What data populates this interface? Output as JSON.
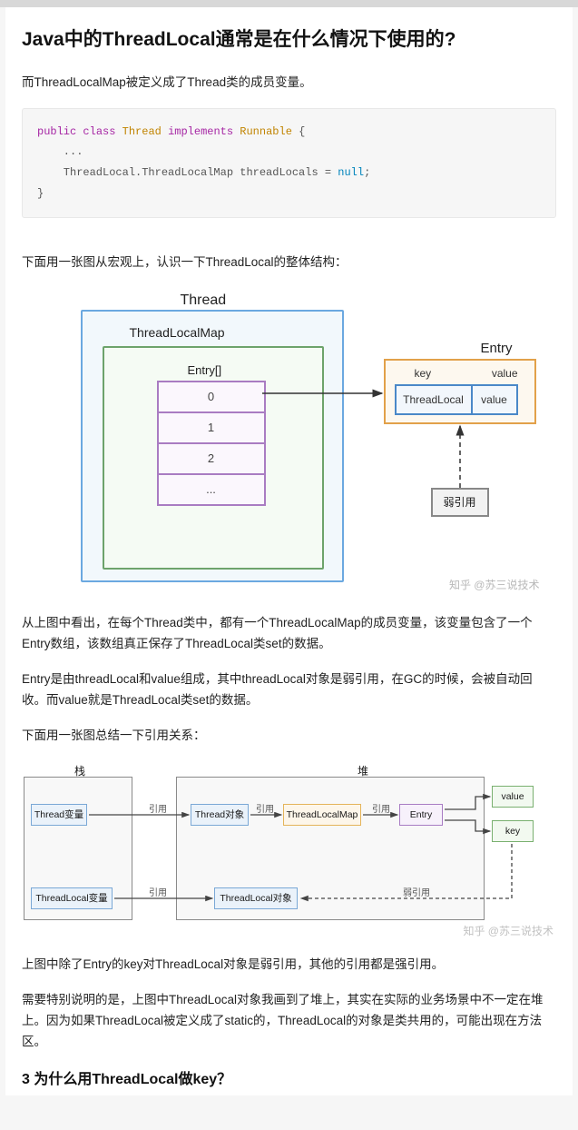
{
  "title": "Java中的ThreadLocal通常是在什么情况下使用的?",
  "paragraphs": {
    "p1": "而ThreadLocalMap被定义成了Thread类的成员变量。",
    "p2": "下面用一张图从宏观上，认识一下ThreadLocal的整体结构：",
    "p3": "从上图中看出，在每个Thread类中，都有一个ThreadLocalMap的成员变量，该变量包含了一个Entry数组，该数组真正保存了ThreadLocal类set的数据。",
    "p4": "Entry是由threadLocal和value组成，其中threadLocal对象是弱引用，在GC的时候，会被自动回收。而value就是ThreadLocal类set的数据。",
    "p5": "下面用一张图总结一下引用关系：",
    "p6": "上图中除了Entry的key对ThreadLocal对象是弱引用，其他的引用都是强引用。",
    "p7": "需要特别说明的是，上图中ThreadLocal对象我画到了堆上，其实在实际的业务场景中不一定在堆上。因为如果ThreadLocal被定义成了static的，ThreadLocal的对象是类共用的，可能出现在方法区。"
  },
  "code": {
    "kw_public": "public",
    "kw_class": "class",
    "type_thread": "Thread",
    "kw_implements": "implements",
    "type_runnable": "Runnable",
    "brace_open": " {",
    "ellipsis": "    ...",
    "field_line_a": "    ThreadLocal.ThreadLocalMap threadLocals = ",
    "lit_null": "null",
    "semicolon": ";",
    "brace_close": "}"
  },
  "diagram1": {
    "thread": "Thread",
    "map": "ThreadLocalMap",
    "entry_array": "Entry[]",
    "cells": [
      "0",
      "1",
      "2",
      "..."
    ],
    "entry": "Entry",
    "key_label": "key",
    "value_label": "value",
    "key_cell": "ThreadLocal",
    "value_cell": "value",
    "weak_ref": "弱引用",
    "watermark": "知乎 @苏三说技术"
  },
  "diagram2": {
    "stack": "栈",
    "heap": "堆",
    "thread_var": "Thread变量",
    "tl_var": "ThreadLocal变量",
    "thread_obj": "Thread对象",
    "tlmap": "ThreadLocalMap",
    "entry": "Entry",
    "tl_obj": "ThreadLocal对象",
    "value": "value",
    "key": "key",
    "ref": "引用",
    "weak_ref": "弱引用",
    "watermark": "知乎 @苏三说技术"
  },
  "next_heading": "3  为什么用ThreadLocal做key？"
}
